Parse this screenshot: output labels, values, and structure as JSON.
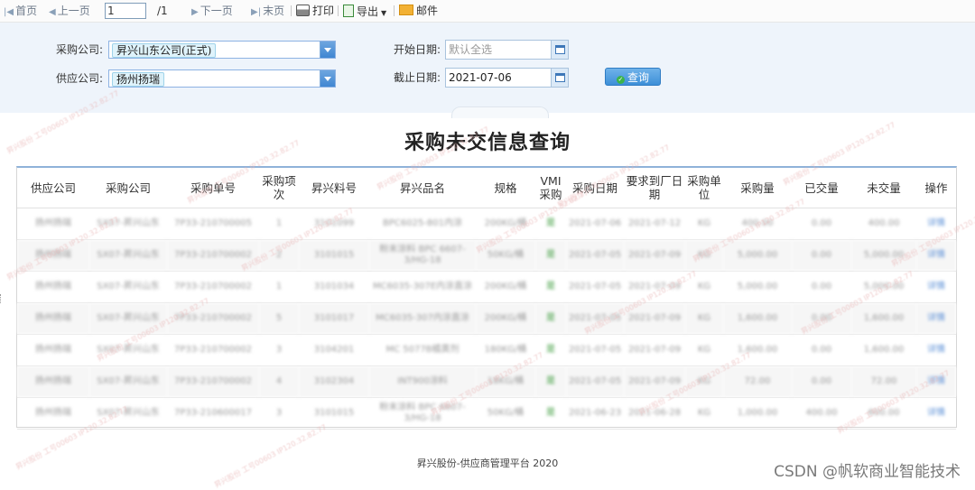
{
  "toolbar": {
    "first": "首页",
    "prev": "上一页",
    "page_value": "1",
    "page_total": "/1",
    "next": "下一页",
    "last": "末页",
    "print": "打印",
    "export": "导出",
    "mail": "邮件"
  },
  "filter": {
    "buyer_label": "采购公司:",
    "buyer_value": "昇兴山东公司(正式)",
    "supplier_label": "供应公司:",
    "supplier_value": "扬州扬瑞",
    "start_label": "开始日期:",
    "start_placeholder": "默认全选",
    "end_label": "截止日期:",
    "end_value": "2021-07-06",
    "query_label": "查询"
  },
  "report_title": "采购未交信息查询",
  "table": {
    "headers": [
      "供应公司",
      "采购公司",
      "采购单号",
      "采购项次",
      "昇兴料号",
      "昇兴品名",
      "规格",
      "VMI采购",
      "采购日期",
      "要求到厂日期",
      "采购单位",
      "采购量",
      "已交量",
      "未交量",
      "操作"
    ],
    "rows": [
      [
        "扬州扬瑞",
        "SX07-昇兴山东",
        "7P33-210700005",
        "1",
        "3101099",
        "BPC6025-801内涂",
        "200KG/桶",
        "是",
        "2021-07-06",
        "2021-07-12",
        "KG",
        "400.00",
        "0.00",
        "400.00",
        "详情"
      ],
      [
        "扬州扬瑞",
        "SX07-昇兴山东",
        "7P33-210700002",
        "2",
        "3101015",
        "粉末涂料 BPC 6607-3/HG-18",
        "50KG/桶",
        "是",
        "2021-07-05",
        "2021-07-09",
        "KG",
        "5,000.00",
        "0.00",
        "5,000.00",
        "详情"
      ],
      [
        "扬州扬瑞",
        "SX07-昇兴山东",
        "7P33-210700002",
        "1",
        "3101034",
        "MC6035-307E内涂直涂",
        "200KG/桶",
        "是",
        "2021-07-05",
        "2021-07-09",
        "KG",
        "5,000.00",
        "0.00",
        "5,000.00",
        "详情"
      ],
      [
        "扬州扬瑞",
        "SX07-昇兴山东",
        "7P33-210700002",
        "5",
        "3101017",
        "MC6035-307内涂直涂",
        "200KG/桶",
        "是",
        "2021-07-05",
        "2021-07-09",
        "KG",
        "1,600.00",
        "0.00",
        "1,600.00",
        "详情"
      ],
      [
        "扬州扬瑞",
        "SX07-昇兴山东",
        "7P33-210700002",
        "3",
        "3104201",
        "MC 5077B橘黄剂",
        "180KG/桶",
        "是",
        "2021-07-05",
        "2021-07-09",
        "KG",
        "1,600.00",
        "0.00",
        "1,600.00",
        "详情"
      ],
      [
        "扬州扬瑞",
        "SX07-昇兴山东",
        "7P33-210700002",
        "4",
        "3102304",
        "INT900涂料",
        "18KG/桶",
        "是",
        "2021-07-05",
        "2021-07-09",
        "KG",
        "72.00",
        "0.00",
        "72.00",
        "详情"
      ],
      [
        "扬州扬瑞",
        "SX07-昇兴山东",
        "7P33-210600017",
        "3",
        "3101015",
        "粉末涂料 BPC 6607-3/HG-18",
        "50KG/桶",
        "是",
        "2021-06-23",
        "2021-06-28",
        "KG",
        "1,000.00",
        "400.00",
        "600.00",
        "详情"
      ]
    ]
  },
  "footer": "昇兴股份-供应商管理平台 2020",
  "brand": "CSDN @帆软商业智能技术",
  "watermark": "昇兴股份 工号00603 IP120.32.82.77"
}
